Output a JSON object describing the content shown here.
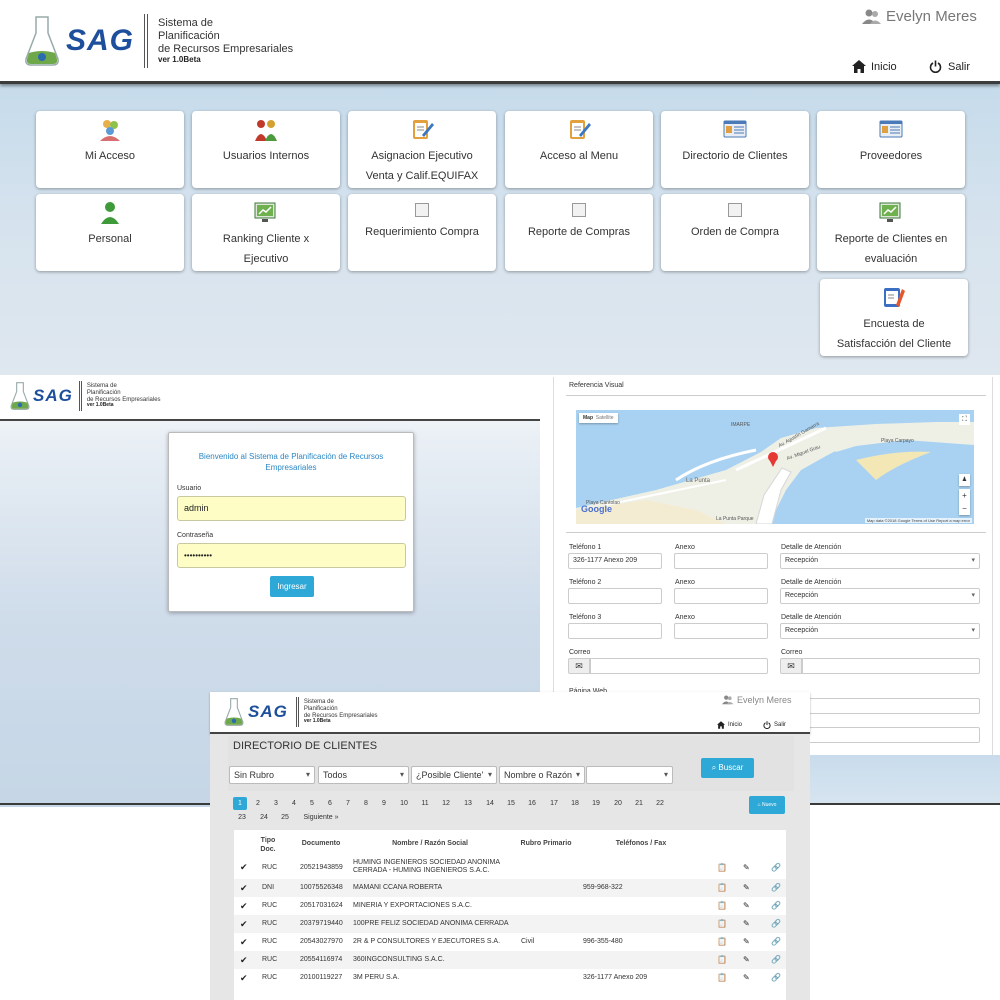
{
  "brand": {
    "logo": "SAG",
    "line1": "Sistema de",
    "line2": "Planificación",
    "line3": "de Recursos Empresariales",
    "version": "ver 1.0Beta"
  },
  "main": {
    "user_name": "Evelyn Meres",
    "nav_home": "Inicio",
    "nav_exit": "Salir",
    "tiles": [
      {
        "line1": "Mi Acceso",
        "line2": "",
        "icon": "users-icon"
      },
      {
        "line1": "Usuarios Internos",
        "line2": "",
        "icon": "user-group-icon"
      },
      {
        "line1": "Asignacion Ejecutivo",
        "line2": "Venta y Calif.EQUIFAX",
        "icon": "edit-clipboard-icon"
      },
      {
        "line1": "Acceso al Menu",
        "line2": "",
        "icon": "edit-clipboard-icon"
      },
      {
        "line1": "Directorio de Clientes",
        "line2": "",
        "icon": "address-card-icon"
      },
      {
        "line1": "Proveedores",
        "line2": "",
        "icon": "address-card-icon"
      },
      {
        "line1": "Personal",
        "line2": "",
        "icon": "person-icon"
      },
      {
        "line1": "Ranking Cliente x",
        "line2": "Ejecutivo",
        "icon": "chart-monitor-icon"
      },
      {
        "line1": "Requerimiento Compra",
        "line2": "",
        "icon": "broken-image-icon"
      },
      {
        "line1": "Reporte de Compras",
        "line2": "",
        "icon": "broken-image-icon"
      },
      {
        "line1": "Orden de Compra",
        "line2": "",
        "icon": "broken-image-icon"
      },
      {
        "line1": "Reporte de Clientes en",
        "line2": "evaluación",
        "icon": "chart-monitor-icon"
      },
      {
        "line1": "Encuesta de",
        "line2": "Satisfacción del Cliente",
        "icon": "survey-icon"
      }
    ]
  },
  "login": {
    "welcome_line1": "Bienvenido al Sistema de Planificación de Recursos",
    "welcome_line2": "Empresariales",
    "user_label": "Usuario",
    "user_value": "admin",
    "pass_label": "Contraseña",
    "pass_value": "••••••••••",
    "submit": "Ingresar"
  },
  "detail": {
    "map_title": "Referencia Visual",
    "map_tab_map": "Map",
    "map_tab_sat": "Satellite",
    "map_footer": "Map data ©2018 Google   Terms of Use   Report a map error",
    "map_labels": [
      "IMARPE",
      "Av. Agustín Gamarra",
      "Av. Miguel Grau",
      "La Punta",
      "Playa Carpayo",
      "Playa Cantolao",
      "La Punta Parque",
      "Google",
      "Playa Arenilla",
      "Playa La Arenilla",
      "Av. Malecón",
      "Alvarez del Villar",
      "Playa Los Cocos",
      "Coronel Bolognesi",
      "Sáenz Peña"
    ],
    "phone1_label": "Teléfono 1",
    "phone1_value": "326-1177  Anexo 209",
    "phone2_label": "Teléfono 2",
    "phone3_label": "Teléfono 3",
    "annex_label": "Anexo",
    "attention_label": "Detalle de Atención",
    "attention_value": "Recepción",
    "email_label": "Correo",
    "web_label": "Página Web"
  },
  "directory": {
    "user_name": "Evelyn Meres",
    "nav_home": "Inicio",
    "nav_exit": "Salir",
    "title": "DIRECTORIO DE CLIENTES",
    "filter1": "Sin Rubro",
    "filter2": "Todos",
    "filter3": "¿Posible Cliente'",
    "filter4": "Nombre o Razón",
    "search_button": "Buscar",
    "new_button": "Nuevo",
    "pages_row1": [
      "1",
      "2",
      "3",
      "4",
      "5",
      "6",
      "7",
      "8",
      "9",
      "10",
      "11",
      "12",
      "13",
      "14",
      "15",
      "16",
      "17",
      "18",
      "19",
      "20",
      "21",
      "22"
    ],
    "pages_row2": [
      "23",
      "24",
      "25",
      "Siguiente  »"
    ],
    "columns": [
      "Tipo Doc.",
      "Documento",
      "Nombre / Razón Social",
      "Rubro Primario",
      "Teléfonos / Fax"
    ],
    "rows": [
      {
        "tipo": "RUC",
        "doc": "20521943859",
        "name1": "HUMING INGENIEROS SOCIEDAD ANONIMA",
        "name2": "CERRADA - HUMING INGENIEROS S.A.C.",
        "rubro": "",
        "tel": ""
      },
      {
        "tipo": "DNI",
        "doc": "10075526348",
        "name1": "MAMANI CCANA ROBERTA",
        "name2": "",
        "rubro": "",
        "tel": "959-968-322"
      },
      {
        "tipo": "RUC",
        "doc": "20517031624",
        "name1": "MINERIA Y EXPORTACIONES S.A.C.",
        "name2": "",
        "rubro": "",
        "tel": ""
      },
      {
        "tipo": "RUC",
        "doc": "20379719440",
        "name1": "100PRE FELIZ SOCIEDAD ANONIMA CERRADA",
        "name2": "",
        "rubro": "",
        "tel": ""
      },
      {
        "tipo": "RUC",
        "doc": "20543027970",
        "name1": "2R & P CONSULTORES Y EJECUTORES S.A.",
        "name2": "",
        "rubro": "Civil",
        "tel": "996-355-480"
      },
      {
        "tipo": "RUC",
        "doc": "20554116974",
        "name1": "360INGCONSULTING S.A.C.",
        "name2": "",
        "rubro": "",
        "tel": ""
      },
      {
        "tipo": "RUC",
        "doc": "20100119227",
        "name1": "3M PERU S.A.",
        "name2": "",
        "rubro": "",
        "tel": "326-1177 Anexo 209"
      }
    ]
  }
}
